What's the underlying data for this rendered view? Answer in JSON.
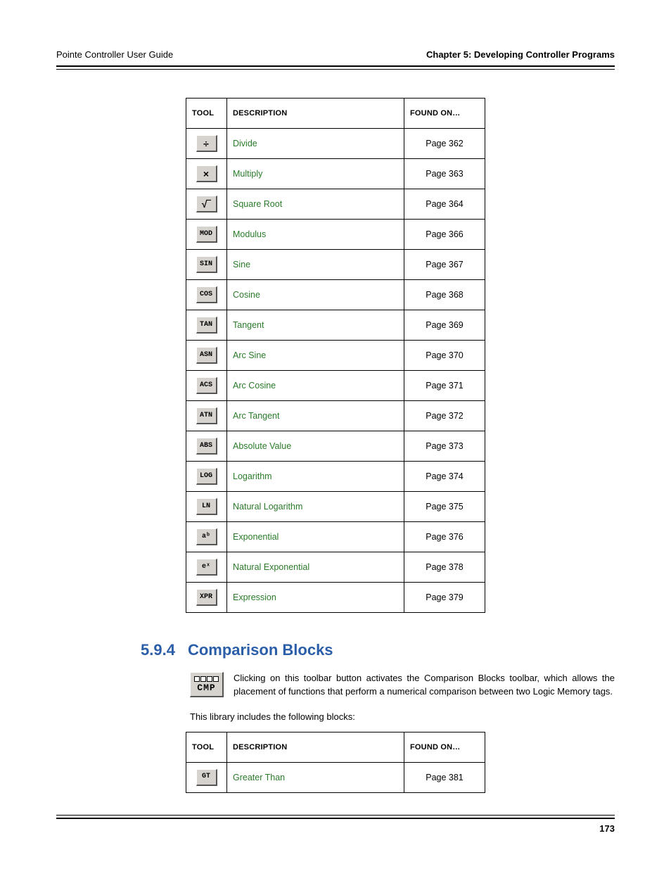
{
  "header": {
    "left": "Pointe Controller User Guide",
    "right": "Chapter 5: Developing Controller Programs"
  },
  "table1": {
    "headers": {
      "tool": "TOOL",
      "description": "DESCRIPTION",
      "found_on": "FOUND ON…"
    },
    "rows": [
      {
        "icon": "÷",
        "sym": true,
        "desc": "Divide",
        "page": "Page 362"
      },
      {
        "icon": "×",
        "sym": true,
        "desc": "Multiply",
        "page": "Page 363"
      },
      {
        "icon": "√‾",
        "sym": true,
        "desc": "Square Root",
        "page": "Page 364"
      },
      {
        "icon": "MOD",
        "sym": false,
        "desc": "Modulus",
        "page": "Page 366"
      },
      {
        "icon": "SIN",
        "sym": false,
        "desc": "Sine",
        "page": "Page 367"
      },
      {
        "icon": "COS",
        "sym": false,
        "desc": "Cosine",
        "page": "Page 368"
      },
      {
        "icon": "TAN",
        "sym": false,
        "desc": "Tangent",
        "page": "Page 369"
      },
      {
        "icon": "ASN",
        "sym": false,
        "desc": "Arc Sine",
        "page": "Page 370"
      },
      {
        "icon": "ACS",
        "sym": false,
        "desc": "Arc Cosine",
        "page": "Page 371"
      },
      {
        "icon": "ATN",
        "sym": false,
        "desc": "Arc Tangent",
        "page": "Page 372"
      },
      {
        "icon": "ABS",
        "sym": false,
        "desc": "Absolute Value",
        "page": "Page 373"
      },
      {
        "icon": "LOG",
        "sym": false,
        "desc": "Logarithm",
        "page": "Page 374"
      },
      {
        "icon": "LN",
        "sym": false,
        "desc": "Natural Logarithm",
        "page": "Page 375"
      },
      {
        "icon": "aᵇ",
        "sym": false,
        "desc": "Exponential",
        "page": "Page 376"
      },
      {
        "icon": "eˣ",
        "sym": false,
        "desc": "Natural Exponential",
        "page": "Page 378"
      },
      {
        "icon": "XPR",
        "sym": false,
        "desc": "Expression",
        "page": "Page 379"
      }
    ]
  },
  "section": {
    "number": "5.9.4",
    "title": "Comparison Blocks",
    "cmp_label": "CMP",
    "paragraph": "Clicking on this toolbar button activates the Comparison Blocks toolbar, which allows the placement of functions that perform a numerical comparison between two Logic Memory tags.",
    "intro": "This library includes the following blocks:"
  },
  "table2": {
    "headers": {
      "tool": "TOOL",
      "description": "DESCRIPTION",
      "found_on": "FOUND ON…"
    },
    "rows": [
      {
        "icon": "GT",
        "sym": false,
        "desc": "Greater Than",
        "page": "Page 381"
      }
    ]
  },
  "footer": {
    "page_number": "173"
  }
}
